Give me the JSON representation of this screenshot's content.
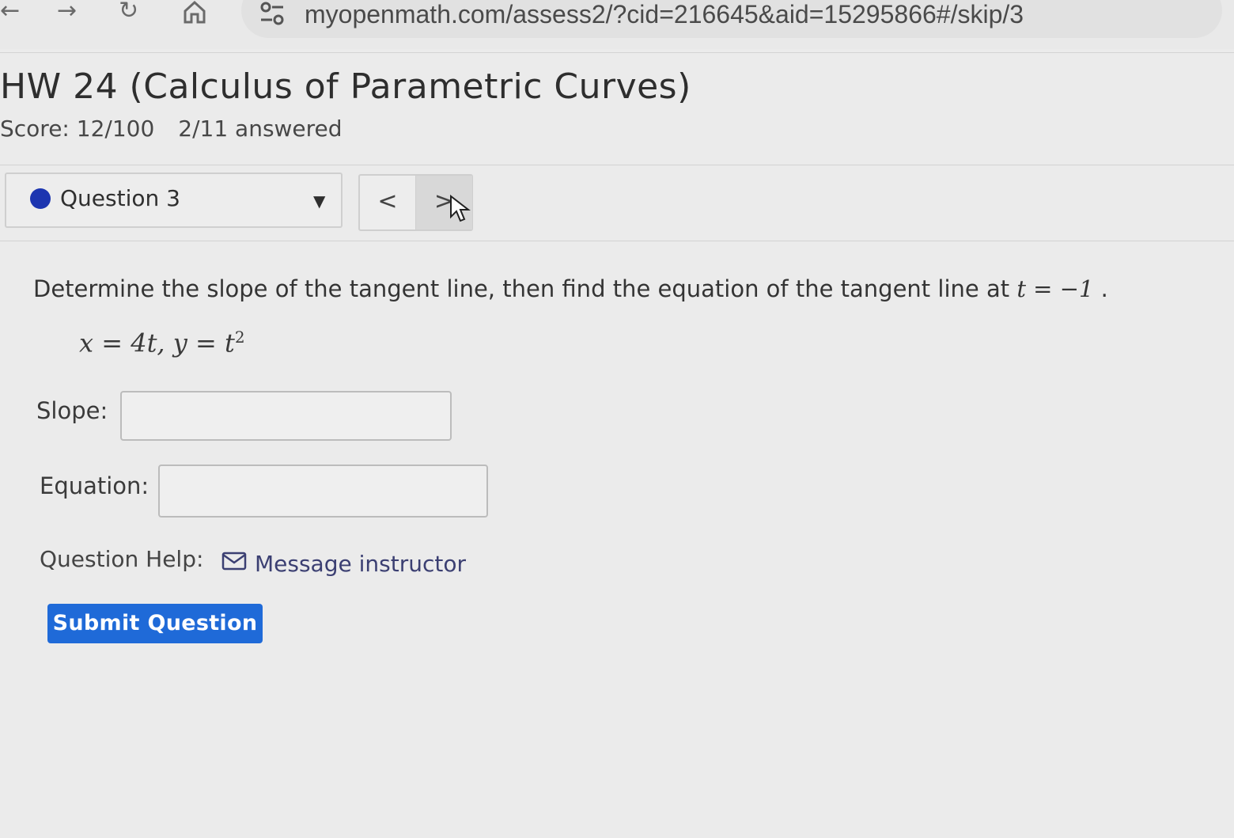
{
  "browser": {
    "url": "myopenmath.com/assess2/?cid=216645&aid=15295866#/skip/3",
    "back_icon": "arrow-left",
    "forward_icon": "arrow-right",
    "reload_icon": "reload",
    "home_icon": "home"
  },
  "header": {
    "title": "HW 24 (Calculus of Parametric Curves)",
    "score": "Score: 12/100",
    "answered": "2/11 answered"
  },
  "question_nav": {
    "selected": "Question 3",
    "prev_label": "<",
    "next_label": ">",
    "status_color": "#1c35b0"
  },
  "question": {
    "prompt_text": "Determine the slope of the tangent line, then find the equation of the tangent line at ",
    "prompt_math": "t = −1",
    "prompt_end": " .",
    "formula_base": "x = 4t, y = t",
    "formula_exp": "2",
    "slope_label": "Slope:",
    "slope_value": "",
    "equation_label": "Equation:",
    "equation_value": "",
    "help_label": "Question Help:",
    "help_link": "Message instructor",
    "submit_label": "Submit Question"
  },
  "colors": {
    "submit": "#1f6ad8",
    "link": "#3b3f72"
  }
}
